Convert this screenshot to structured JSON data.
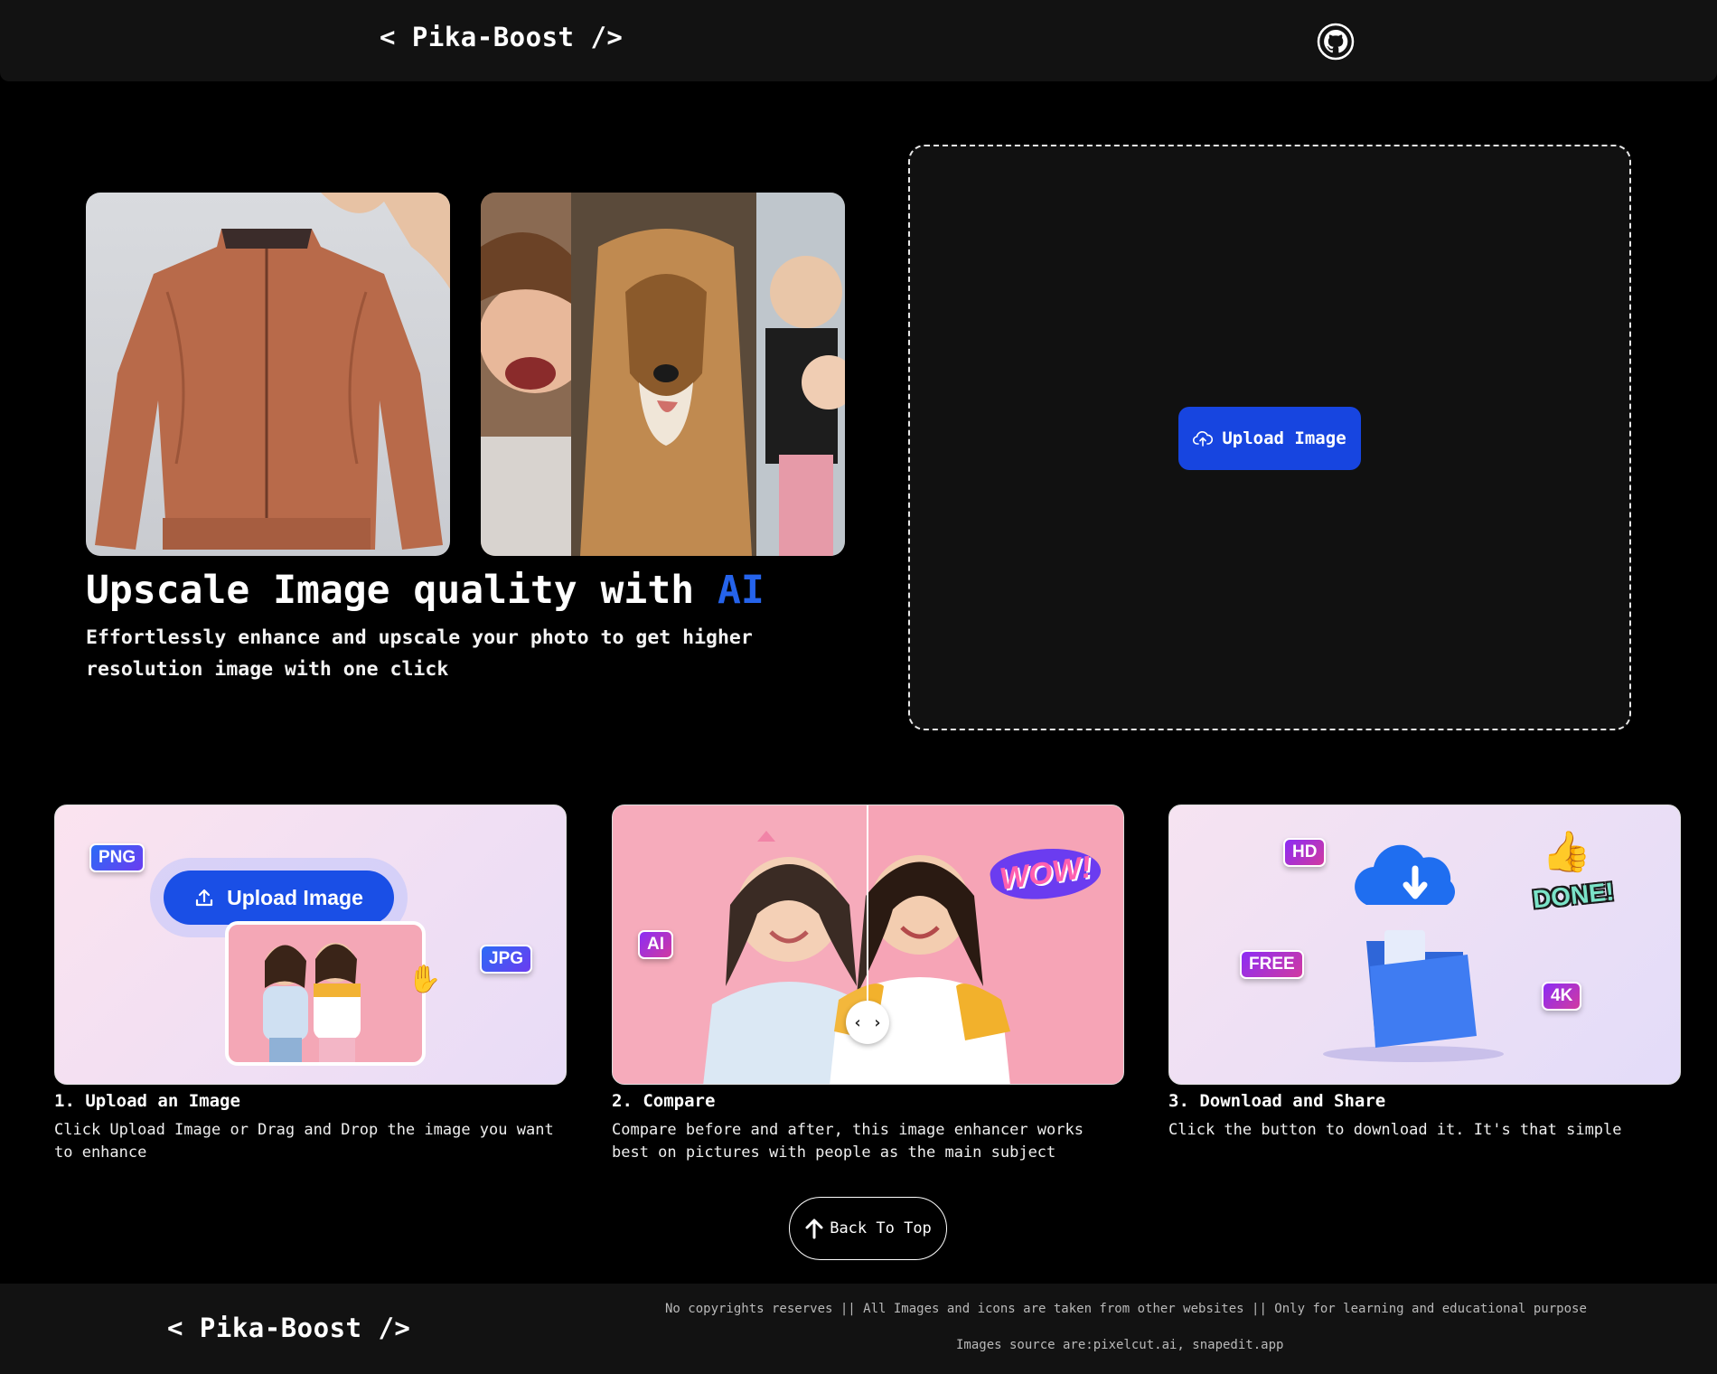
{
  "nav": {
    "brand": "< Pika-Boost />",
    "github_icon": "github-icon"
  },
  "hero": {
    "title_main": "Upscale Image quality with",
    "title_accent": "AI",
    "subtitle": "Effortlessly enhance and upscale your photo to get higher resolution image with one click"
  },
  "upload": {
    "button_label": "Upload Image",
    "icon": "cloud-upload-icon"
  },
  "steps": [
    {
      "title": "1. Upload an Image",
      "desc": "Click Upload Image or Drag and Drop the image you want to enhance",
      "illustration": {
        "button_label": "Upload Image",
        "badges": [
          "PNG",
          "JPG"
        ]
      }
    },
    {
      "title": "2. Compare",
      "desc": "Compare before and after, this image enhancer works best on pictures with people as the main subject",
      "illustration": {
        "badges": [
          "AI"
        ],
        "sticker": "WOW!"
      }
    },
    {
      "title": "3. Download and Share",
      "desc": "Click the button to download it. It's that simple",
      "illustration": {
        "badges": [
          "HD",
          "FREE",
          "4K"
        ],
        "sticker": "DONE!"
      }
    }
  ],
  "back_to_top": {
    "label": "Back To Top",
    "icon": "arrow-up-icon"
  },
  "footer": {
    "brand": "< Pika-Boost />",
    "notice": "No copyrights reserves || All Images and icons are taken from other websites || Only for learning and educational purpose",
    "sources": "Images source are:pixelcut.ai, snapedit.app"
  },
  "colors": {
    "accent": "#2563eb",
    "upload_button": "#1745e0",
    "background": "#000000",
    "panel": "#121212"
  }
}
